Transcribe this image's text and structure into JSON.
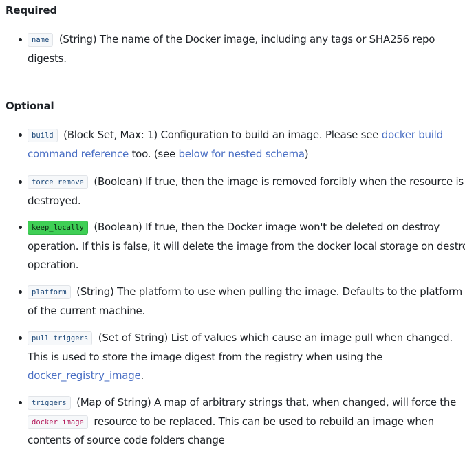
{
  "required": {
    "heading": "Required",
    "items": [
      {
        "code": "name",
        "lines": [
          "(String) The name of the Docker image, including any tags or SHA256 repo",
          "digests."
        ]
      }
    ]
  },
  "optional": {
    "heading": "Optional",
    "build": {
      "code": "build",
      "text1": "(Block Set, Max: 1) Configuration to build an image. Please see",
      "link1_part1": "docker build",
      "link1_part2": "command reference",
      "text2": "too. (see",
      "link2": "below for nested schema",
      "text3": ")"
    },
    "force_remove": {
      "code": "force_remove",
      "lines": [
        "(Boolean) If true, then the image is removed forcibly when the resource is",
        "destroyed."
      ]
    },
    "keep_locally": {
      "code": "keep_locally",
      "lines": [
        "(Boolean) If true, then the Docker image won't be deleted on destroy",
        "operation. If this is false, it will delete the image from the docker local storage on destroy",
        "operation."
      ]
    },
    "platform": {
      "code": "platform",
      "lines": [
        "(String) The platform to use when pulling the image. Defaults to the platform",
        "of the current machine."
      ]
    },
    "pull_triggers": {
      "code": "pull_triggers",
      "lines": [
        "(Set of String) List of values which cause an image pull when changed.",
        "This is used to store the image digest from the registry when using the"
      ],
      "link": "docker_registry_image",
      "after_link": "."
    },
    "triggers": {
      "code": "triggers",
      "line1": "(Map of String) A map of arbitrary strings that, when changed, will force the",
      "code2": "docker_image",
      "line2": "resource to be replaced. This can be used to rebuild an image when",
      "line3": "contents of source code folders change"
    }
  }
}
